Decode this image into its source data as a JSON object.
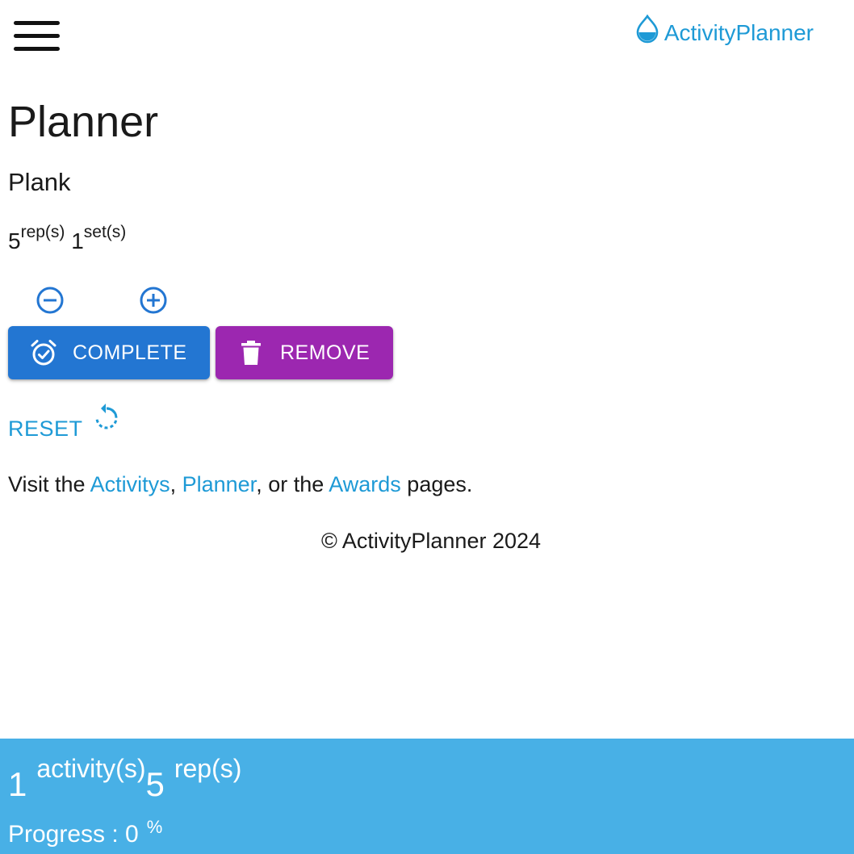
{
  "header": {
    "menu_icon": "hamburger-menu-icon",
    "brand_icon": "water-drop-icon",
    "brand_name": "ActivityPlanner",
    "brand_color": "#1e9ad6"
  },
  "main": {
    "title": "Planner",
    "activity_name": "Plank",
    "reps_value": "5",
    "reps_unit": "rep(s)",
    "sets_value": "1",
    "sets_unit": "set(s)",
    "decrement_icon": "minus-circle-icon",
    "increment_icon": "plus-circle-icon",
    "complete_label": "COMPLETE",
    "complete_icon": "alarm-check-icon",
    "complete_color": "#2376d2",
    "remove_label": "REMOVE",
    "remove_icon": "trash-icon",
    "remove_color": "#9c27b0",
    "reset_label": "RESET",
    "reset_icon": "restart-icon"
  },
  "visit": {
    "prefix": "Visit the ",
    "link_activitys": "Activitys",
    "sep1": ", ",
    "link_planner": "Planner",
    "sep2": ", or the ",
    "link_awards": "Awards",
    "suffix": " pages."
  },
  "footer": {
    "copyright": "© ActivityPlanner 2024"
  },
  "stats": {
    "activity_count": "1",
    "activity_unit": "activity(s)",
    "rep_count": "5",
    "rep_unit": "rep(s)",
    "progress_label": "Progress : 0",
    "progress_unit": "%",
    "bar_color": "#48b0e6"
  }
}
